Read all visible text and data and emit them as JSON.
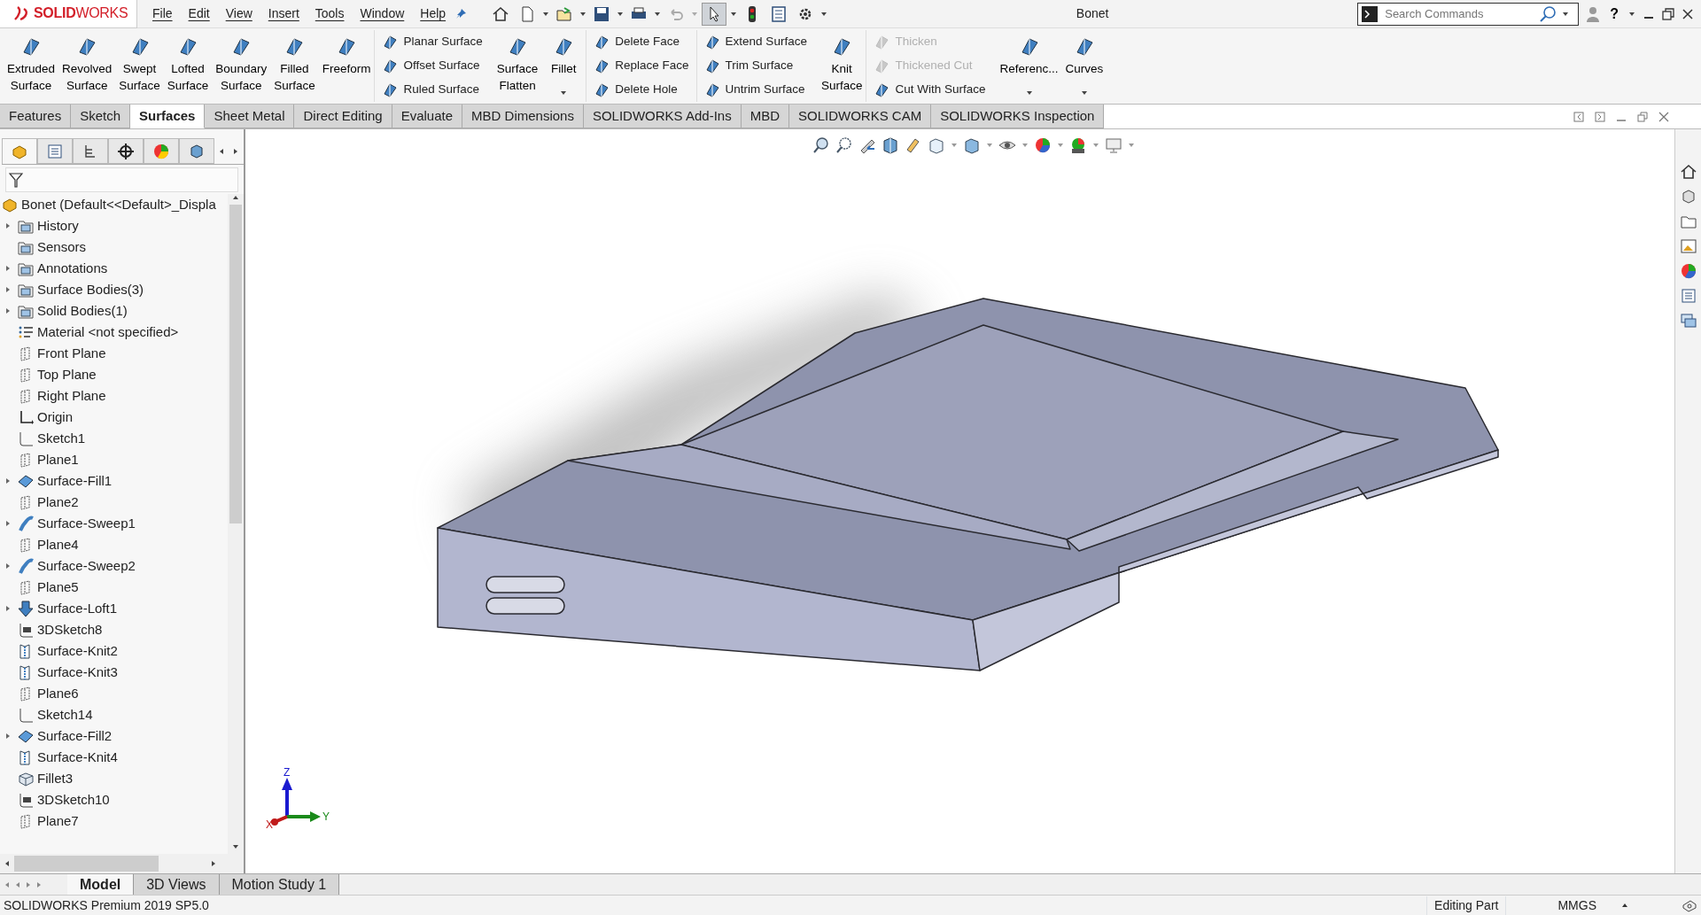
{
  "app": {
    "logo": "**SOLID**WORKS",
    "menu": [
      "File",
      "Edit",
      "View",
      "Insert",
      "Tools",
      "Window",
      "Help"
    ],
    "title": "Bonet",
    "search": {
      "placeholder": "Search Commands"
    },
    "help": "?"
  },
  "ribbon": [
    {
      "kind": "large",
      "label": "Extruded Surface"
    },
    {
      "kind": "large",
      "label": "Revolved Surface"
    },
    {
      "kind": "large",
      "label": "Swept Surface"
    },
    {
      "kind": "large",
      "label": "Lofted Surface"
    },
    {
      "kind": "large",
      "label": "Boundary Surface"
    },
    {
      "kind": "large",
      "label": "Filled Surface"
    },
    {
      "kind": "large",
      "label": "Freeform"
    },
    {
      "kind": "stack",
      "items": [
        {
          "label": "Planar Surface",
          "disabled": false
        },
        {
          "label": "Offset Surface",
          "disabled": false
        },
        {
          "label": "Ruled Surface",
          "disabled": false
        }
      ]
    },
    {
      "kind": "large",
      "label": "Surface Flatten"
    },
    {
      "kind": "large",
      "label": "Fillet",
      "dropdown": true
    },
    {
      "kind": "stack",
      "items": [
        {
          "label": "Delete Face",
          "disabled": false
        },
        {
          "label": "Replace Face",
          "disabled": false
        },
        {
          "label": "Delete Hole",
          "disabled": false
        }
      ]
    },
    {
      "kind": "stack",
      "items": [
        {
          "label": "Extend Surface",
          "disabled": false
        },
        {
          "label": "Trim Surface",
          "disabled": false
        },
        {
          "label": "Untrim Surface",
          "disabled": false
        }
      ]
    },
    {
      "kind": "large",
      "label": "Knit Surface"
    },
    {
      "kind": "stack",
      "items": [
        {
          "label": "Thicken",
          "disabled": true
        },
        {
          "label": "Thickened Cut",
          "disabled": true
        },
        {
          "label": "Cut With Surface",
          "disabled": false
        }
      ]
    },
    {
      "kind": "large",
      "label": "Referenc...",
      "dropdown": true
    },
    {
      "kind": "large",
      "label": "Curves",
      "dropdown": true
    }
  ],
  "tabs": [
    {
      "label": "Features",
      "selected": false
    },
    {
      "label": "Sketch",
      "selected": false
    },
    {
      "label": "Surfaces",
      "selected": true
    },
    {
      "label": "Sheet Metal",
      "selected": false
    },
    {
      "label": "Direct Editing",
      "selected": false
    },
    {
      "label": "Evaluate",
      "selected": false
    },
    {
      "label": "MBD Dimensions",
      "selected": false
    },
    {
      "label": "SOLIDWORKS Add-Ins",
      "selected": false
    },
    {
      "label": "MBD",
      "selected": false
    },
    {
      "label": "SOLIDWORKS CAM",
      "selected": false
    },
    {
      "label": "SOLIDWORKS Inspection",
      "selected": false
    }
  ],
  "panel_tabs": [
    {
      "selected": true
    },
    {
      "selected": false
    },
    {
      "selected": false
    },
    {
      "selected": false
    },
    {
      "selected": false
    },
    {
      "selected": false
    }
  ],
  "tree": {
    "root": "Bonet  (Default<<Default>_Displa",
    "items": [
      {
        "label": "History",
        "kind": "folder",
        "expandable": true
      },
      {
        "label": "Sensors",
        "kind": "folder",
        "expandable": false
      },
      {
        "label": "Annotations",
        "kind": "folder",
        "expandable": true
      },
      {
        "label": "Surface Bodies(3)",
        "kind": "folder",
        "expandable": true
      },
      {
        "label": "Solid Bodies(1)",
        "kind": "folder",
        "expandable": true
      },
      {
        "label": "Material <not specified>",
        "kind": "material",
        "expandable": false
      },
      {
        "label": "Front Plane",
        "kind": "plane",
        "expandable": false
      },
      {
        "label": "Top Plane",
        "kind": "plane",
        "expandable": false
      },
      {
        "label": "Right Plane",
        "kind": "plane",
        "expandable": false
      },
      {
        "label": "Origin",
        "kind": "origin",
        "expandable": false
      },
      {
        "label": "Sketch1",
        "kind": "sketch",
        "expandable": false
      },
      {
        "label": "Plane1",
        "kind": "plane",
        "expandable": false
      },
      {
        "label": "Surface-Fill1",
        "kind": "surface",
        "expandable": true
      },
      {
        "label": "Plane2",
        "kind": "plane",
        "expandable": false
      },
      {
        "label": "Surface-Sweep1",
        "kind": "sweep",
        "expandable": true
      },
      {
        "label": "Plane4",
        "kind": "plane",
        "expandable": false
      },
      {
        "label": "Surface-Sweep2",
        "kind": "sweep",
        "expandable": true
      },
      {
        "label": "Plane5",
        "kind": "plane",
        "expandable": false
      },
      {
        "label": "Surface-Loft1",
        "kind": "loft",
        "expandable": true
      },
      {
        "label": "3DSketch8",
        "kind": "sketch3d",
        "expandable": false
      },
      {
        "label": "Surface-Knit2",
        "kind": "knit",
        "expandable": false
      },
      {
        "label": "Surface-Knit3",
        "kind": "knit",
        "expandable": false
      },
      {
        "label": "Plane6",
        "kind": "plane",
        "expandable": false
      },
      {
        "label": "Sketch14",
        "kind": "sketch",
        "expandable": false
      },
      {
        "label": "Surface-Fill2",
        "kind": "surface",
        "expandable": true
      },
      {
        "label": "Surface-Knit4",
        "kind": "knit",
        "expandable": false
      },
      {
        "label": "Fillet3",
        "kind": "solid",
        "expandable": false
      },
      {
        "label": "3DSketch10",
        "kind": "sketch3d",
        "expandable": false
      },
      {
        "label": "Plane7",
        "kind": "plane",
        "expandable": false
      }
    ]
  },
  "triad": {
    "x": "X",
    "y": "Y",
    "z": "Z"
  },
  "bottom_tabs": [
    {
      "label": "Model",
      "selected": true
    },
    {
      "label": "3D Views",
      "selected": false
    },
    {
      "label": "Motion Study 1",
      "selected": false
    }
  ],
  "status_bar": {
    "version": "SOLIDWORKS Premium 2019 SP5.0",
    "mode": "Editing Part",
    "units": "MMGS"
  }
}
